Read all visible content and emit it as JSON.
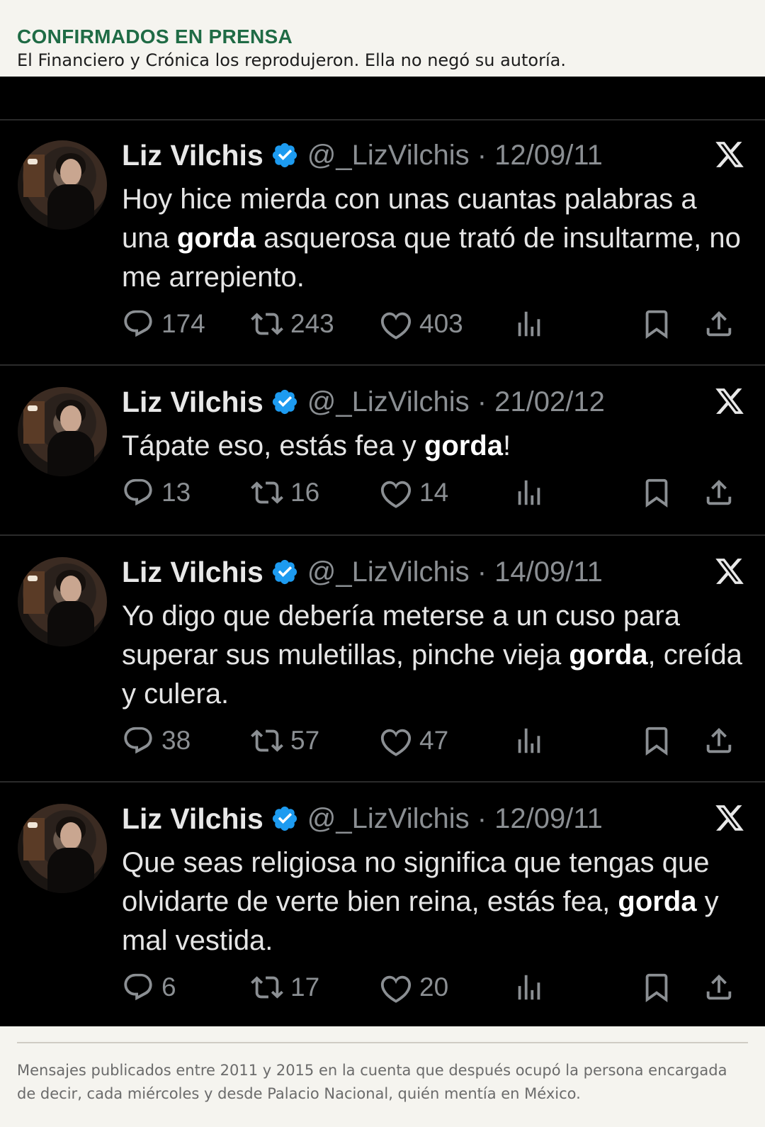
{
  "header": {
    "kicker": "CONFIRMADOS EN PRENSA",
    "subtitle": "El Financiero y Crónica los reprodujeron. Ella no negó su autoría."
  },
  "tweets": [
    {
      "name": "Liz Vilchis",
      "handle_date": "@_LizVilchis · 12/09/11",
      "text_parts": [
        "Hoy hice mierda con unas cuantas palabras a una ",
        "gorda",
        " asquerosa que trató de insultarme, no me arrepiento."
      ],
      "replies": "174",
      "reposts": "243",
      "likes": "403"
    },
    {
      "name": "Liz Vilchis",
      "handle_date": "@_LizVilchis · 21/02/12",
      "text_parts": [
        "Tápate eso, estás fea y ",
        "gorda",
        "!"
      ],
      "replies": "13",
      "reposts": "16",
      "likes": "14"
    },
    {
      "name": "Liz Vilchis",
      "handle_date": "@_LizVilchis · 14/09/11",
      "text_parts": [
        "Yo digo que debería meterse a un cuso para superar sus muletillas, pinche vieja ",
        "gorda",
        ", creída y culera."
      ],
      "replies": "38",
      "reposts": "57",
      "likes": "47"
    },
    {
      "name": "Liz Vilchis",
      "handle_date": "@_LizVilchis · 12/09/11",
      "text_parts": [
        "Que seas religiosa no significa que tengas que olvidarte de verte bien reina, estás fea, ",
        "gorda",
        " y mal vestida."
      ],
      "replies": "6",
      "reposts": "17",
      "likes": "20"
    }
  ],
  "footer": {
    "caption": "Mensajes publicados entre 2011 y 2015 en la cuenta que después ocupó la persona encargada de decir, cada miércoles y desde Palacio Nacional, quién mentía en México."
  },
  "colors": {
    "kicker": "#1f6b45",
    "verified": "#1d9bf0",
    "muted": "#8b8f93",
    "background_dark": "#000000"
  },
  "icons": [
    "reply-icon",
    "repost-icon",
    "like-icon",
    "views-icon",
    "bookmark-icon",
    "share-icon",
    "x-logo-icon",
    "verified-badge-icon"
  ]
}
